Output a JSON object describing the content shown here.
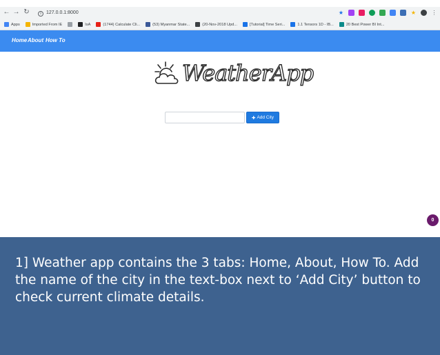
{
  "browser": {
    "url": "127.0.0.1:8000",
    "bookmarks": [
      {
        "label": "Apps",
        "color": "#4285f4"
      },
      {
        "label": "Imported From IE",
        "color": "#f4b400"
      },
      {
        "label": "",
        "color": "#9aa0a6"
      },
      {
        "label": "IsA",
        "color": "#202124"
      },
      {
        "label": "(1744) Calculate Cli...",
        "color": "#e62117"
      },
      {
        "label": "(53) Myanmar State...",
        "color": "#3b5998"
      },
      {
        "label": "(20-Nov-2018 Upd...",
        "color": "#3c4043"
      },
      {
        "label": "[Tutorial] Time Seri...",
        "color": "#1a73e8"
      },
      {
        "label": "1.1 Tensors 1D - IB...",
        "color": "#1a73e8"
      },
      {
        "label": "20 Best Power BI Int...",
        "color": "#0b8a8a"
      }
    ],
    "extension_colors": [
      "#1a73e8",
      "#a142f4",
      "#e91e63",
      "#0f9d58",
      "#34a853",
      "#4285f4",
      "#3c6eb4",
      "#f4b400",
      "#3c4043"
    ]
  },
  "nav": {
    "home": "Home",
    "about": "About",
    "how_to": "How To"
  },
  "logo": {
    "text": "WeatherApp"
  },
  "form": {
    "city_value": "",
    "add_label": "Add City"
  },
  "badge": {
    "count": "0"
  },
  "caption": {
    "text": "1] Weather app contains the 3 tabs: Home, About, How To. Add the name of the city in the text-box next to ‘Add City’ button to check current climate details."
  }
}
